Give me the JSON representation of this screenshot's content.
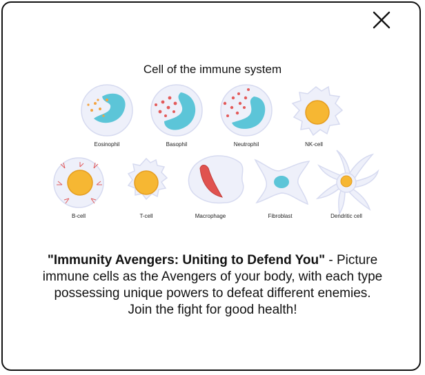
{
  "illustration": {
    "title": "Cell of the immune system",
    "cells": [
      {
        "label": "Eosinophil"
      },
      {
        "label": "Basophil"
      },
      {
        "label": "Neutrophil"
      },
      {
        "label": "NK-cell"
      },
      {
        "label": "B-cell"
      },
      {
        "label": "T-cell"
      },
      {
        "label": "Macrophage"
      },
      {
        "label": "Fibroblast"
      },
      {
        "label": "Dendritic cell"
      }
    ]
  },
  "description": {
    "headline": "\"Immunity Avengers: Uniting to Defend You\"",
    "separator": " - ",
    "body": "Picture immune cells as the Avengers of your body, with each type possessing unique powers to defeat different enemies. Join the fight for good health!"
  },
  "colors": {
    "cell_membrane": "#eef0fa",
    "nucleus_blue": "#5cc5d8",
    "nucleus_yellow": "#f6b733",
    "granule_red": "#e35a5a",
    "granule_orange": "#f4a340",
    "macrophage_red": "#e0524f"
  },
  "icons": {
    "close": "close-x-icon"
  }
}
